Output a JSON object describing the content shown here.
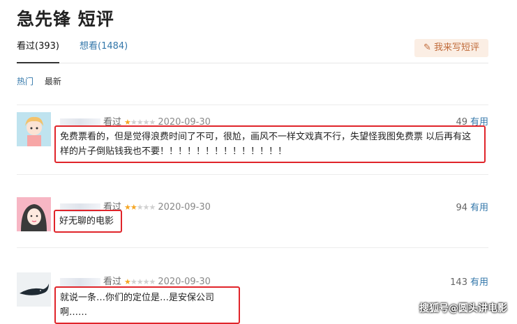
{
  "page": {
    "title": "急先锋 短评"
  },
  "tabs": [
    {
      "label": "看过(393)"
    },
    {
      "label": "想看(1484)"
    }
  ],
  "write_button": {
    "label": "我来写短评"
  },
  "sort": {
    "hot": "热门",
    "latest": "最新"
  },
  "comments": [
    {
      "status": "看过",
      "rating": 1,
      "date": "2020-09-30",
      "votes": "49",
      "useful_label": "有用",
      "text": "免费票看的，但是觉得浪费时间了不可，很尬，画风不一样文戏真不行，失望怪我图免费票 以后再有这样的片子倒贴钱我也不要！！！！！！！！！！！！！！"
    },
    {
      "status": "看过",
      "rating": 2,
      "date": "2020-09-30",
      "votes": "94",
      "useful_label": "有用",
      "text": "好无聊的电影"
    },
    {
      "status": "看过",
      "rating": 1,
      "date": "2020-09-30",
      "votes": "143",
      "useful_label": "有用",
      "text": "就说一条…你们的定位是…是安保公司啊……"
    }
  ],
  "watermark": "搜狐号@圆头讲电影",
  "colors": {
    "link": "#3377aa",
    "highlight_border": "#e0242a",
    "star": "#f5a623"
  }
}
